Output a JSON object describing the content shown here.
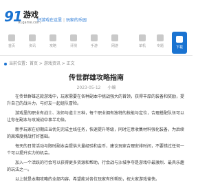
{
  "header": {
    "logo_text": "91",
    "logo_suffix": "游戏",
    "logo_domain": "91game.com",
    "slogan_left": "好游戏在这里",
    "slogan_right": "玩家的乐园"
  },
  "nav": {
    "items": [
      {
        "label": "首页",
        "icon": "home-icon"
      },
      {
        "label": "资讯",
        "icon": "news-icon"
      },
      {
        "label": "攻略",
        "icon": "guide-icon"
      },
      {
        "label": "评测",
        "icon": "review-icon"
      },
      {
        "label": "手游",
        "icon": "phone-icon"
      },
      {
        "label": "网游",
        "icon": "globe-icon"
      },
      {
        "label": "单机",
        "icon": "disc-icon"
      },
      {
        "label": "专题",
        "icon": "topic-icon"
      },
      {
        "label": "下载",
        "icon": "download-icon"
      }
    ],
    "active_index": 8,
    "accent": "#1a73d1"
  },
  "breadcrumb": {
    "text": "当前位置：首页 > 游戏资讯 > 正文"
  },
  "article": {
    "title": "传世群雄攻略指南",
    "meta_date": "2023-05-12",
    "meta_author": "小编",
    "paragraphs": [
      "在传世群雄这款游戏中，玩家需要在各种副本中挑战强大的首领，获得丰厚的装备和奖励，提升自己的战斗力，与好友一起组队冒险。",
      "游戏里的职业有战士、法师与道士三种，每个职业拥有独特的技能与定位，合理搭配队伍可以让你在副本与攻城战中事半功倍。",
      "新手玩家在初期应当优先完成主线任务，快速提升等级，同时注意收集材料强化装备，为后续的高难度挑战打好基础。",
      "每天的日常活动与限时副本会提供大量经验和金币，建议玩家合理安排时间，不要错过任何一个可以提升实力的机会。",
      "加入一个活跃的行会可以获得更多资源和帮助，行会战与沙城争夺是游戏中最激烈、最具乐趣的玩法之一。",
      "以上就是本期攻略的全部内容，希望能对各位玩家有所帮助，祝大家游戏愉快。"
    ]
  }
}
